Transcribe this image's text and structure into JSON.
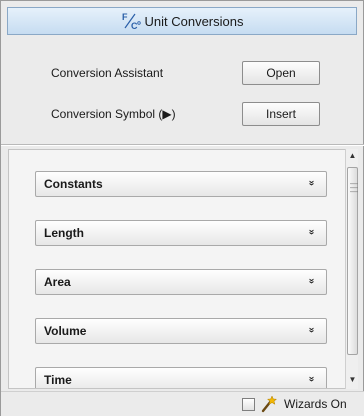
{
  "header": {
    "title": "Unit Conversions",
    "icon": "unit-conversion-icon"
  },
  "assistant": {
    "conversion_assistant_label": "Conversion Assistant",
    "open_button": "Open",
    "conversion_symbol_label": "Conversion Symbol (▶)",
    "insert_button": "Insert"
  },
  "categories": [
    {
      "label": "Constants",
      "icon": "expand-chevron-icon"
    },
    {
      "label": "Length",
      "icon": "expand-chevron-icon"
    },
    {
      "label": "Area",
      "icon": "expand-chevron-icon"
    },
    {
      "label": "Volume",
      "icon": "expand-chevron-icon"
    },
    {
      "label": "Time",
      "icon": "expand-chevron-icon"
    }
  ],
  "chevron_glyph": "»",
  "footer": {
    "wizards_label": "Wizards On",
    "wizards_checked": false,
    "icon": "magic-wand-icon"
  },
  "colors": {
    "title_bar": "#c6dcf1",
    "panel_background": "#ebebeb"
  }
}
